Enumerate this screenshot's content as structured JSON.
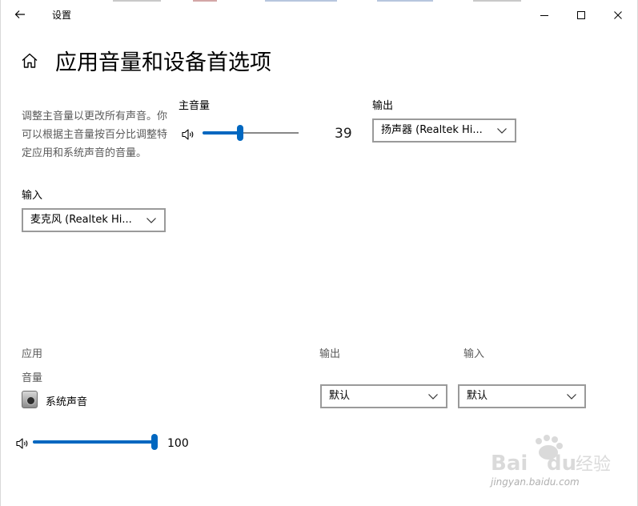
{
  "window": {
    "title": "设置",
    "controls": {
      "minimize": "—",
      "maximize": "☐",
      "close": "✕"
    }
  },
  "page": {
    "title": "应用音量和设备首选项"
  },
  "description": "调整主音量以更改所有声音。你可以根据主音量按百分比调整特定应用和系统声音的音量。",
  "master": {
    "label": "主音量",
    "value": "39",
    "level": 39,
    "output_label": "输出",
    "output_device": "扬声器 (Realtek Hi..."
  },
  "input": {
    "label": "输入",
    "device": "麦克风 (Realtek Hi..."
  },
  "apps": {
    "header_app": "应用",
    "header_output": "输出",
    "header_input": "输入",
    "volume_label": "音量",
    "items": [
      {
        "name": "系统声音",
        "icon": "system-sounds-icon",
        "output": "默认",
        "input": "默认",
        "value": "100",
        "level": 100
      }
    ]
  },
  "watermark": {
    "brand": "Baidu经验",
    "url": "jingyan.baidu.com"
  },
  "colors": {
    "accent": "#0067c0",
    "muted_text": "#5a5a5a"
  }
}
